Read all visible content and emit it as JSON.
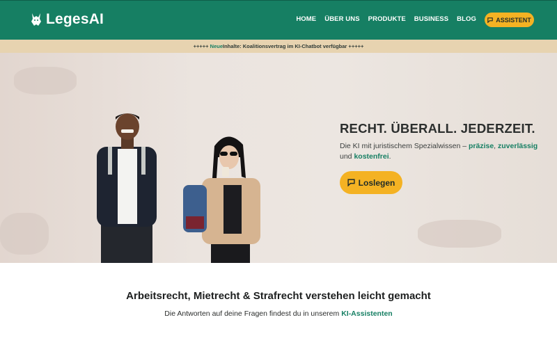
{
  "header": {
    "logo_text": "LegesAI",
    "logo_icon": "lynx-icon",
    "nav": [
      "HOME",
      "ÜBER UNS",
      "PRODUKTE",
      "BUSINESS",
      "BLOG"
    ],
    "assistant_label": "ASSISTENT",
    "assistant_icon": "chat-bubble-icon",
    "colors": {
      "brand": "#167f63",
      "accent": "#f4b223"
    }
  },
  "announcement": {
    "prefix": "+++++ ",
    "highlight": "Neue",
    "text": " Inhalte: Koalitionsvertrag im KI-Chatbot verfügbar +++++"
  },
  "hero": {
    "title": "RECHT. ÜBERALL. JEDERZEIT.",
    "sub_1": "Die KI mit juristischem Spezialwissen – ",
    "hl_1": "präzise",
    "sub_2": ", ",
    "hl_2": "zuverlässig",
    "sub_3": " und ",
    "hl_3": "kostenfrei",
    "sub_4": ".",
    "cta_label": "Loslegen",
    "cta_icon": "chat-bubble-icon"
  },
  "section": {
    "title": "Arbeitsrecht, Mietrecht & Strafrecht verstehen leicht gemacht",
    "sub_prefix": "Die Antworten auf deine Fragen findest du in unserem ",
    "sub_highlight": "KI-Assistenten"
  }
}
